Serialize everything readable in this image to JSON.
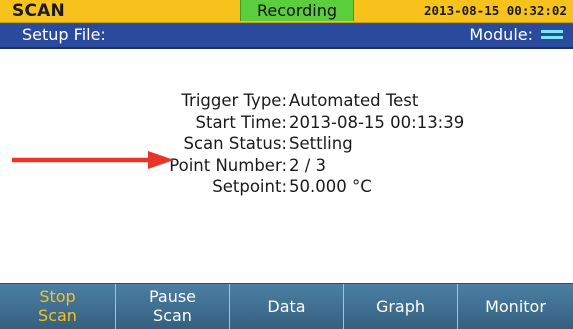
{
  "status_bar": {
    "app_title": "SCAN",
    "recording": "Recording",
    "datetime": "2013-08-15 00:32:02"
  },
  "info_bar": {
    "setup_file_label": "Setup File:",
    "module_label": "Module:",
    "module_icon": "module-indicator-icon"
  },
  "details": [
    {
      "label": "Trigger Type:",
      "value": "Automated Test"
    },
    {
      "label": "Start Time:",
      "value": "2013-08-15 00:13:39"
    },
    {
      "label": "Scan Status:",
      "value": "Settling"
    },
    {
      "label": "Point Number:",
      "value": "2 / 3"
    },
    {
      "label": "Setpoint:",
      "value": "50.000 °C"
    }
  ],
  "annotation": {
    "arrow_color": "#e8352a",
    "icon": "red-arrow-icon"
  },
  "softkeys": [
    {
      "line1": "Stop",
      "line2": "Scan"
    },
    {
      "line1": "Pause",
      "line2": "Scan"
    },
    {
      "label": "Data"
    },
    {
      "label": "Graph"
    },
    {
      "label": "Monitor"
    }
  ],
  "colors": {
    "status_yellow": "#f7c21b",
    "recording_green": "#5ccd3c",
    "header_blue": "#2a4a9e",
    "softkey_blue": "#3d6a8a",
    "active_softkey_text": "#f7c21b"
  }
}
